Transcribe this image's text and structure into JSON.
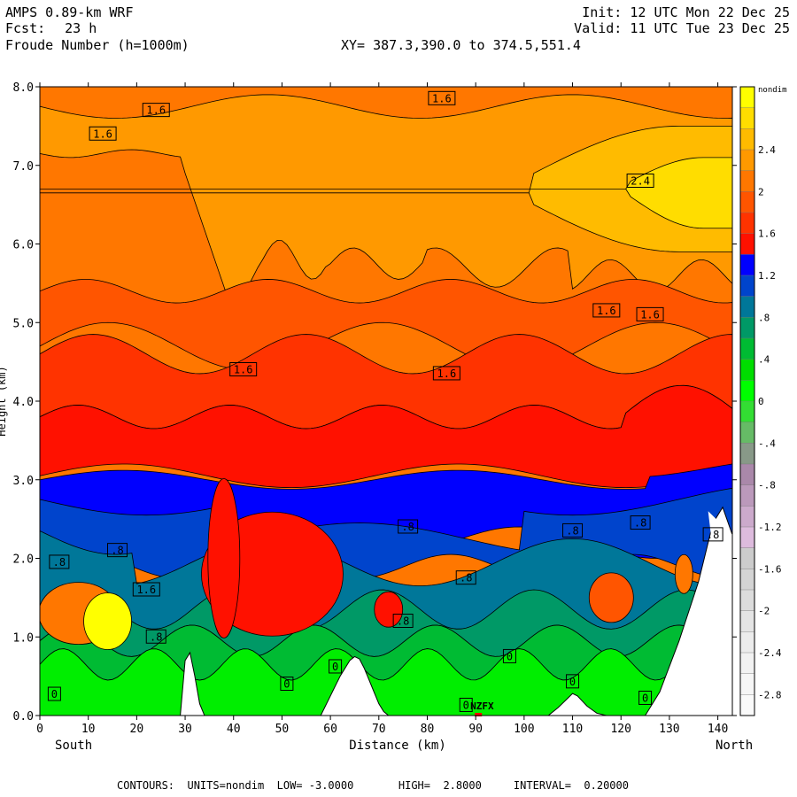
{
  "header": {
    "model": "AMPS 0.89-km WRF",
    "fcst_label": "Fcst:",
    "fcst_value": "23 h",
    "field": "Froude Number (h=1000m)",
    "init": "Init: 12 UTC Mon 22 Dec 25",
    "valid": "Valid: 11 UTC Tue 23 Dec 25",
    "xy": "XY= 387.3,390.0 to 374.5,551.4"
  },
  "footer": {
    "contours": "CONTOURS:  UNITS=nondim  LOW= -3.0000       HIGH=  2.8000     INTERVAL=  0.20000"
  },
  "chart_data": {
    "type": "heatmap",
    "title": "Froude Number (h=1000m)",
    "xlabel": "Distance (km)",
    "ylabel": "Height (km)",
    "xlim": [
      0,
      143
    ],
    "ylim": [
      0,
      8
    ],
    "x_ticks": [
      0,
      10,
      20,
      30,
      40,
      50,
      60,
      70,
      80,
      90,
      100,
      110,
      120,
      130,
      140
    ],
    "y_ticks": [
      "0.0",
      "1.0",
      "2.0",
      "3.0",
      "4.0",
      "5.0",
      "6.0",
      "7.0",
      "8.0"
    ],
    "x_end_labels": {
      "left": "South",
      "right": "North"
    },
    "colorbar": {
      "unit": "nondim",
      "labels": [
        "2.4",
        "2",
        "1.6",
        "1.2",
        ".8",
        ".4",
        "0",
        "-.4",
        "-.8",
        "-1.2",
        "-1.6",
        "-2",
        "-2.4",
        "-2.8"
      ],
      "colors": [
        "#ffff00",
        "#ffdd00",
        "#ffbb00",
        "#ff9900",
        "#ff7700",
        "#ff5500",
        "#ff3300",
        "#ff1100",
        "#0000ff",
        "#0044cc",
        "#007799",
        "#009966",
        "#00bb33",
        "#00dd00",
        "#00ff00",
        "#33dd33",
        "#66bb66",
        "#889988",
        "#aa88aa",
        "#bb99bb",
        "#ccaacc",
        "#ddbbdd",
        "#cccccc",
        "#d4d4d4",
        "#dcdcdc",
        "#e4e4e4",
        "#ececec",
        "#f2f2f2",
        "#f6f6f6",
        "#fafafa"
      ]
    },
    "terrain_x": [
      0,
      29,
      30,
      31,
      32,
      33,
      34,
      35,
      36,
      37,
      45,
      55,
      58,
      62,
      63,
      64,
      65,
      66,
      67,
      68,
      69,
      70,
      71,
      72,
      73,
      74,
      105,
      107,
      109,
      110,
      111,
      113,
      115,
      117,
      120,
      125,
      128,
      132,
      136,
      139,
      141,
      143
    ],
    "terrain_y": [
      0,
      0,
      0.7,
      0.8,
      0.5,
      0.15,
      0,
      0,
      0,
      0,
      0,
      0,
      0,
      0.5,
      0.6,
      0.7,
      0.75,
      0.72,
      0.6,
      0.45,
      0.3,
      0.15,
      0.05,
      0,
      0,
      0,
      0,
      0.1,
      0.22,
      0.28,
      0.25,
      0.12,
      0.03,
      0,
      0,
      0,
      0.3,
      0.95,
      1.7,
      2.45,
      2.65,
      2.3
    ],
    "contour_labels": [
      {
        "x": 24,
        "y": 7.7,
        "t": "1.6"
      },
      {
        "x": 13,
        "y": 7.4,
        "t": "1.6"
      },
      {
        "x": 83,
        "y": 7.85,
        "t": "1.6"
      },
      {
        "x": 124,
        "y": 6.8,
        "t": "2.4"
      },
      {
        "x": 117,
        "y": 5.15,
        "t": "1.6"
      },
      {
        "x": 126,
        "y": 5.1,
        "t": "1.6"
      },
      {
        "x": 42,
        "y": 4.4,
        "t": "1.6"
      },
      {
        "x": 84,
        "y": 4.35,
        "t": "1.6"
      },
      {
        "x": 124,
        "y": 2.45,
        "t": ".8"
      },
      {
        "x": 76,
        "y": 2.4,
        "t": ".8"
      },
      {
        "x": 110,
        "y": 2.35,
        "t": ".8"
      },
      {
        "x": 139,
        "y": 2.3,
        "t": ".8"
      },
      {
        "x": 16,
        "y": 2.1,
        "t": ".8"
      },
      {
        "x": 4,
        "y": 1.95,
        "t": ".8"
      },
      {
        "x": 88,
        "y": 1.75,
        "t": ".8"
      },
      {
        "x": 22,
        "y": 1.6,
        "t": "1.6"
      },
      {
        "x": 75,
        "y": 1.2,
        "t": ".8"
      },
      {
        "x": 24,
        "y": 1.0,
        "t": ".8"
      },
      {
        "x": 97,
        "y": 0.75,
        "t": "0"
      },
      {
        "x": 61,
        "y": 0.62,
        "t": "0"
      },
      {
        "x": 51,
        "y": 0.4,
        "t": "0"
      },
      {
        "x": 110,
        "y": 0.43,
        "t": "0"
      },
      {
        "x": 3,
        "y": 0.27,
        "t": "0"
      },
      {
        "x": 88,
        "y": 0.13,
        "t": "0"
      },
      {
        "x": 125,
        "y": 0.22,
        "t": "0"
      }
    ],
    "station": {
      "x": 90,
      "y": 0.1,
      "t": "NZFX"
    }
  }
}
